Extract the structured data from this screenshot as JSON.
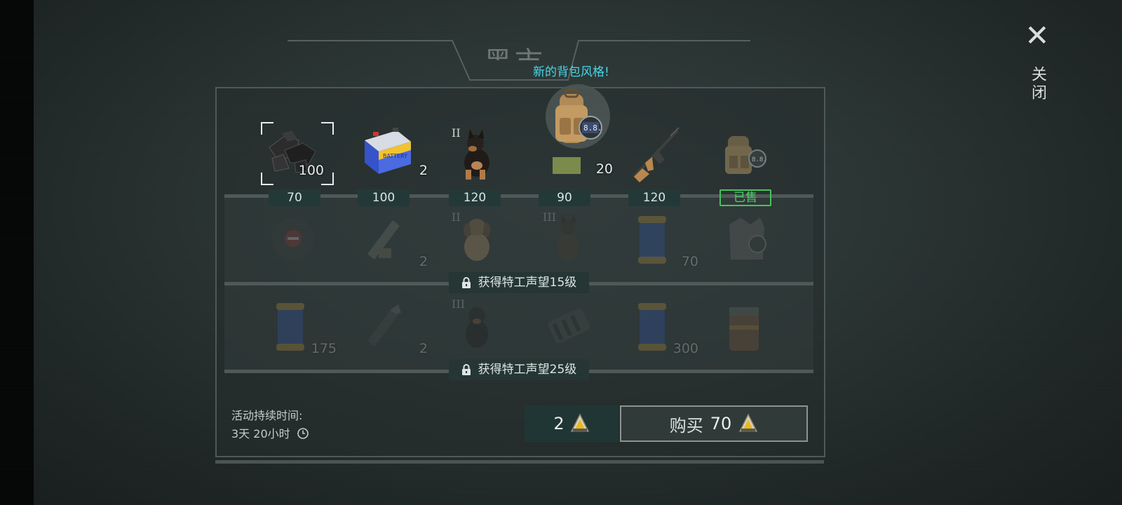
{
  "header": {
    "title": "黑市",
    "banner": "新的背包风格!",
    "close_label": "关闭"
  },
  "rows": [
    {
      "items": [
        {
          "name": "coal",
          "qty": "100",
          "tier": "",
          "price": "70",
          "selected": true
        },
        {
          "name": "battery",
          "qty": "2",
          "tier": "",
          "price": "100"
        },
        {
          "name": "dog-puppy",
          "qty": "",
          "tier": "II",
          "price": "120"
        },
        {
          "name": "backpack-style",
          "qty": "20",
          "tier": "",
          "price": "90",
          "featured": true,
          "badge": "8.8."
        },
        {
          "name": "rifle",
          "qty": "",
          "tier": "",
          "price": "120"
        },
        {
          "name": "backpack",
          "qty": "",
          "tier": "",
          "price": "已售",
          "sold": true
        }
      ]
    },
    {
      "locked": true,
      "lock_text": "获得特工声望15级",
      "items": [
        {
          "name": "disc",
          "qty": "",
          "tier": ""
        },
        {
          "name": "rocket",
          "qty": "2",
          "tier": ""
        },
        {
          "name": "dog-spaniel",
          "qty": "",
          "tier": "II"
        },
        {
          "name": "dog-shepherd",
          "qty": "",
          "tier": "III"
        },
        {
          "name": "canister",
          "qty": "70",
          "tier": ""
        },
        {
          "name": "armor-vest",
          "qty": "",
          "tier": ""
        }
      ]
    },
    {
      "locked": true,
      "lock_text": "获得特工声望25级",
      "items": [
        {
          "name": "canister",
          "qty": "175",
          "tier": ""
        },
        {
          "name": "rocket",
          "qty": "2",
          "tier": ""
        },
        {
          "name": "dog-rottweiler",
          "qty": "",
          "tier": "III"
        },
        {
          "name": "engine-part",
          "qty": "",
          "tier": ""
        },
        {
          "name": "canister",
          "qty": "300",
          "tier": ""
        },
        {
          "name": "supply-crate",
          "qty": "",
          "tier": ""
        }
      ]
    }
  ],
  "footer": {
    "duration_label": "活动持续时间:",
    "duration_value": "3天 20小时",
    "stock": "2",
    "buy_label": "购买",
    "buy_price": "70"
  },
  "colors": {
    "accent_cyan": "#49d6e8",
    "sold_green": "#52d06a",
    "price_bg": "#223837"
  },
  "icons": [
    "close-icon",
    "clock-icon",
    "lock-icon",
    "coin-icon"
  ]
}
